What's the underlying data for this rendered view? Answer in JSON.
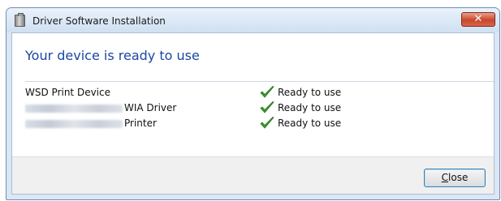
{
  "window": {
    "title": "Driver Software Installation",
    "close_symbol": "✕"
  },
  "main": {
    "heading": "Your device is ready to use",
    "devices": [
      {
        "name": "WSD Print Device",
        "status": "Ready to use",
        "status_icon": "green-check-icon"
      },
      {
        "name": "WIA Driver",
        "status": "Ready to use",
        "status_icon": "green-check-icon",
        "name_prefix_redacted": true
      },
      {
        "name": "Printer",
        "status": "Ready to use",
        "status_icon": "green-check-icon",
        "name_prefix_redacted": true
      }
    ]
  },
  "footer": {
    "close_button": {
      "accel": "C",
      "rest": "lose"
    }
  },
  "colors": {
    "heading": "#1b46a4",
    "check": "#3a9a2a",
    "close_button_title": "#c9462c"
  }
}
